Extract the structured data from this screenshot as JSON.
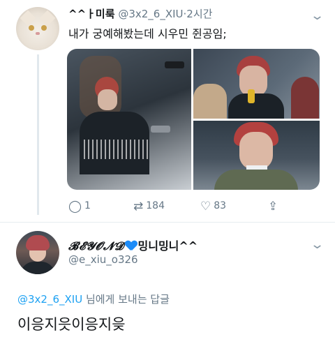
{
  "tweet": {
    "name": "^^ㅏ미룩",
    "handle": "@3x2_6_XIU",
    "separator": "·",
    "time": "2시간",
    "text": "내가 궁예해봤는데 시우민 쥔공임;",
    "actions": {
      "reply_count": "1",
      "retweet_count": "184",
      "like_count": "83"
    }
  },
  "reply": {
    "display_name_fancy": "𝓑𝓔𝓨𝓞𝓝𝓓",
    "display_name_suffix": "밍니밍니^^",
    "handle": "@e_xiu_o326",
    "reply_to_handle": "@3x2_6_XIU",
    "reply_to_suffix": " 님에게 보내는 답글",
    "text": "이응지읏이응지읒"
  },
  "icons": {
    "reply": "reply-icon",
    "retweet": "retweet-icon",
    "like": "like-icon",
    "share": "share-icon",
    "more": "chevron-down-icon"
  },
  "colors": {
    "link": "#1da1f2",
    "muted": "#657786",
    "heart": "#1d8cf8"
  }
}
